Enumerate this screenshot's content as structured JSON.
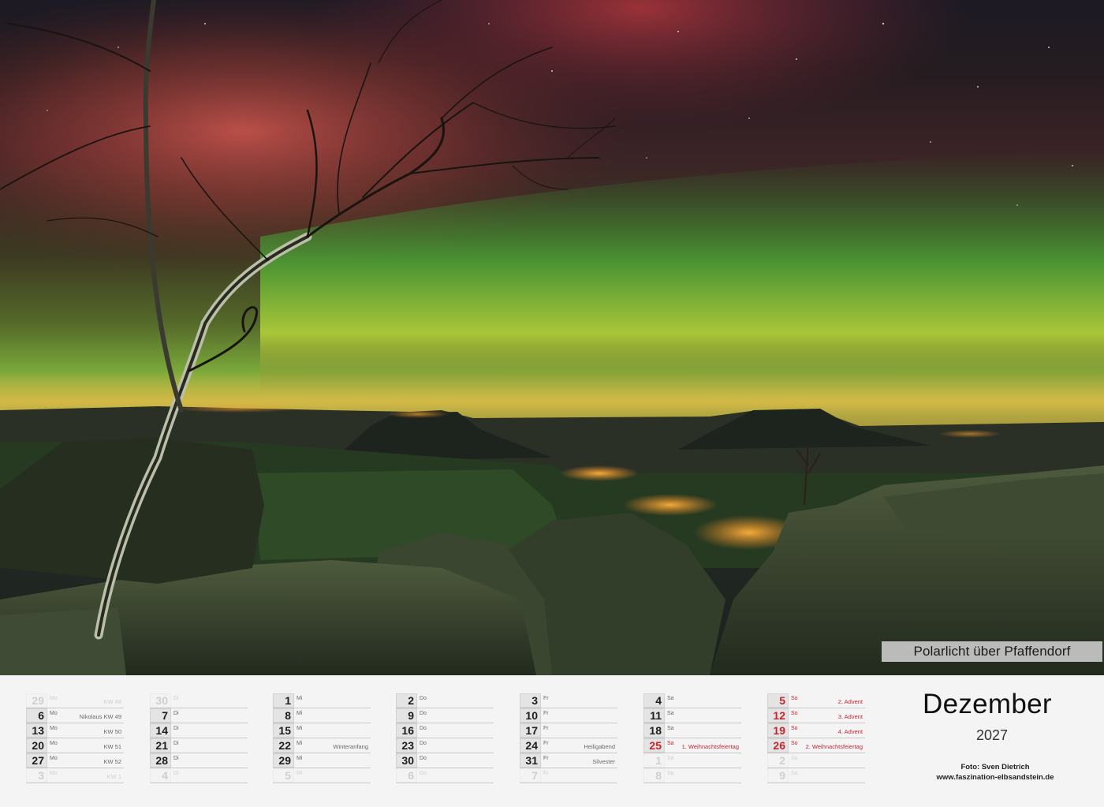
{
  "photo": {
    "caption": "Polarlicht über Pfaffendorf"
  },
  "calendar": {
    "month": "Dezember",
    "year": "2027",
    "credit_line1": "Foto: Sven Dietrich",
    "credit_line2": "www.faszination-elbsandstein.de",
    "colors": {
      "sunday_red": "#c6252c",
      "ghost_grey": "#cfcfcf"
    },
    "columns": [
      {
        "weekday": "Mo",
        "days": [
          {
            "n": "29",
            "note": "KW 48",
            "ghost": true
          },
          {
            "n": "6",
            "note": "Nikolaus  KW 49"
          },
          {
            "n": "13",
            "note": "KW 50"
          },
          {
            "n": "20",
            "note": "KW 51"
          },
          {
            "n": "27",
            "note": "KW 52"
          },
          {
            "n": "3",
            "note": "KW 1",
            "ghost": true
          }
        ]
      },
      {
        "weekday": "Di",
        "days": [
          {
            "n": "30",
            "ghost": true
          },
          {
            "n": "7"
          },
          {
            "n": "14"
          },
          {
            "n": "21"
          },
          {
            "n": "28"
          },
          {
            "n": "4",
            "ghost": true
          }
        ]
      },
      {
        "weekday": "Mi",
        "days": [
          {
            "n": "1"
          },
          {
            "n": "8"
          },
          {
            "n": "15"
          },
          {
            "n": "22",
            "note": "Winteranfang"
          },
          {
            "n": "29"
          },
          {
            "n": "5",
            "ghost": true
          }
        ]
      },
      {
        "weekday": "Do",
        "days": [
          {
            "n": "2"
          },
          {
            "n": "9"
          },
          {
            "n": "16"
          },
          {
            "n": "23"
          },
          {
            "n": "30"
          },
          {
            "n": "6",
            "ghost": true
          }
        ]
      },
      {
        "weekday": "Fr",
        "days": [
          {
            "n": "3"
          },
          {
            "n": "10"
          },
          {
            "n": "17"
          },
          {
            "n": "24",
            "note": "Heiligabend"
          },
          {
            "n": "31",
            "note": "Silvester"
          },
          {
            "n": "7",
            "ghost": true
          }
        ]
      },
      {
        "weekday": "Sa",
        "days": [
          {
            "n": "4"
          },
          {
            "n": "11"
          },
          {
            "n": "18"
          },
          {
            "n": "25",
            "note": "1. Weihnachtsfeiertag",
            "sun": true
          },
          {
            "n": "1",
            "ghost": true
          },
          {
            "n": "8",
            "ghost": true
          }
        ]
      },
      {
        "weekday": "So",
        "sun": true,
        "days": [
          {
            "n": "5",
            "note": "2. Advent",
            "sun": true
          },
          {
            "n": "12",
            "note": "3. Advent",
            "sun": true
          },
          {
            "n": "19",
            "note": "4. Advent",
            "sun": true
          },
          {
            "n": "26",
            "note": "2. Weihnachtsfeiertag",
            "sun": true
          },
          {
            "n": "2",
            "ghost": true
          },
          {
            "n": "9",
            "ghost": true
          }
        ]
      }
    ]
  }
}
